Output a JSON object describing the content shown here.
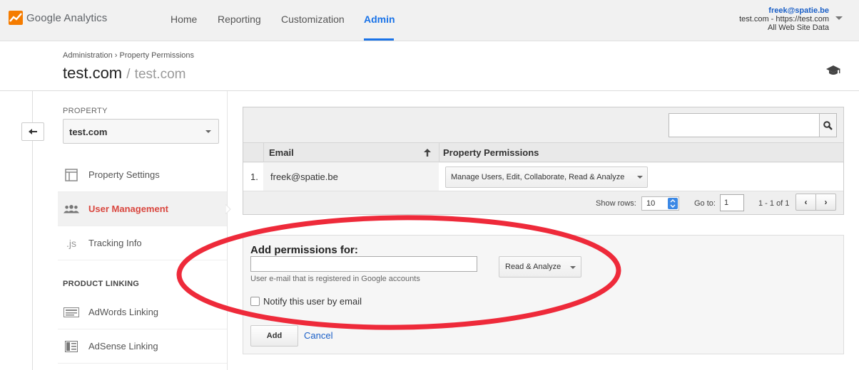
{
  "app": {
    "logo_text": "Google Analytics",
    "brand_color": "#f57c00"
  },
  "nav": {
    "items": [
      "Home",
      "Reporting",
      "Customization",
      "Admin"
    ],
    "active": "Admin",
    "active_color": "#1a73e8"
  },
  "account": {
    "email": "freek@spatie.be",
    "property": "test.com - https://test.com",
    "view": "All Web Site Data"
  },
  "breadcrumb": {
    "root": "Administration",
    "separator": "›",
    "current": "Property Permissions"
  },
  "title": {
    "main": "test.com",
    "separator": "/",
    "sub": "test.com"
  },
  "sidebar": {
    "property_label": "PROPERTY",
    "property_value": "test.com",
    "items": [
      {
        "label": "Property Settings",
        "icon": "window-icon"
      },
      {
        "label": "User Management",
        "icon": "users-icon",
        "active": true
      },
      {
        "label": "Tracking Info",
        "icon": "js-icon"
      }
    ],
    "section_label": "PRODUCT LINKING",
    "linking_items": [
      {
        "label": "AdWords Linking",
        "icon": "adwords-icon"
      },
      {
        "label": "AdSense Linking",
        "icon": "adsense-icon"
      }
    ],
    "active_color": "#d9463e"
  },
  "table": {
    "search_placeholder": "",
    "columns": [
      "Email",
      "Property Permissions"
    ],
    "rows": [
      {
        "num": "1.",
        "email": "freek@spatie.be",
        "permissions": "Manage Users, Edit, Collaborate, Read & Analyze"
      }
    ],
    "pager": {
      "show_rows_label": "Show rows:",
      "show_rows_value": "10",
      "goto_label": "Go to:",
      "goto_value": "1",
      "range": "1 - 1 of 1",
      "prev": "‹",
      "next": "›"
    }
  },
  "add_permissions": {
    "title": "Add permissions for:",
    "input_value": "",
    "hint": "User e-mail that is registered in Google accounts",
    "level": "Read & Analyze",
    "notify_label": "Notify this user by email",
    "notify_checked": false,
    "add_label": "Add",
    "cancel_label": "Cancel"
  },
  "highlight_color": "#ee2a3a"
}
